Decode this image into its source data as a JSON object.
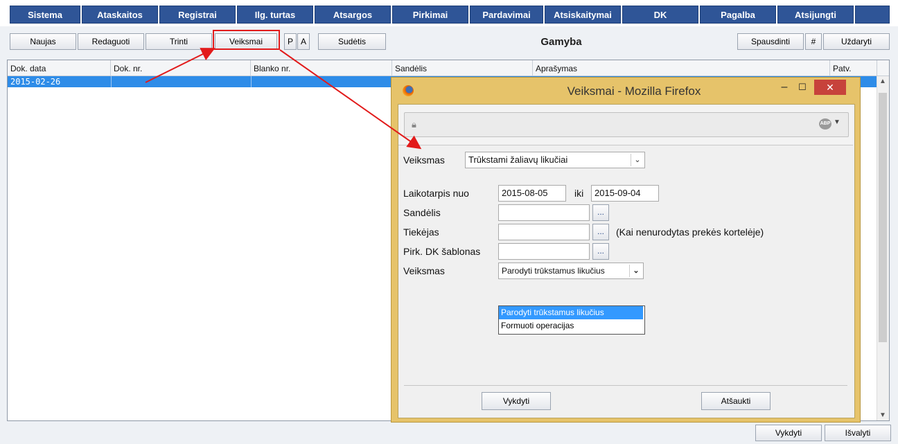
{
  "menu": [
    "Sistema",
    "Ataskaitos",
    "Registrai",
    "Ilg. turtas",
    "Atsargos",
    "Pirkimai",
    "Pardavimai",
    "Atsiskaitymai",
    "DK",
    "Pagalba",
    "Atsijungti"
  ],
  "toolbar": {
    "new": "Naujas",
    "edit": "Redaguoti",
    "delete": "Trinti",
    "actions": "Veiksmai",
    "p": "P",
    "a": "A",
    "composition": "Sudėtis",
    "title": "Gamyba",
    "print": "Spausdinti",
    "hash": "#",
    "close": "Uždaryti"
  },
  "grid": {
    "columns": [
      "Dok. data",
      "Dok. nr.",
      "Blanko nr.",
      "Sandėlis",
      "Aprašymas",
      "Patv."
    ],
    "rows": [
      [
        "2015-02-26",
        "",
        "",
        "",
        "",
        ""
      ]
    ]
  },
  "bottom": {
    "execute": "Vykdyti",
    "clear": "Išvalyti"
  },
  "dialog": {
    "title": "Veiksmai - Mozilla Firefox",
    "action_label": "Veiksmas",
    "action_value": "Trūkstami žaliavų likučiai",
    "period_label": "Laikotarpis nuo",
    "date_from": "2015-08-05",
    "to_label": "iki",
    "date_to": "2015-09-04",
    "warehouse_label": "Sandėlis",
    "supplier_label": "Tiekėjas",
    "supplier_note": "(Kai nenurodytas prekės kortelėje)",
    "template_label": "Pirk. DK šablonas",
    "action2_label": "Veiksmas",
    "action2_value": "Parodyti trūkstamus likučius",
    "options": [
      "Parodyti trūkstamus likučius",
      "Formuoti operacijas"
    ],
    "execute": "Vykdyti",
    "cancel": "Atšaukti",
    "dots": "...",
    "abp": "ABP"
  },
  "colors": {
    "menu_bg": "#2f5597",
    "selection": "#2e8ce8",
    "dialog_frame": "#e6c36a",
    "annotation": "#e21b1b"
  }
}
